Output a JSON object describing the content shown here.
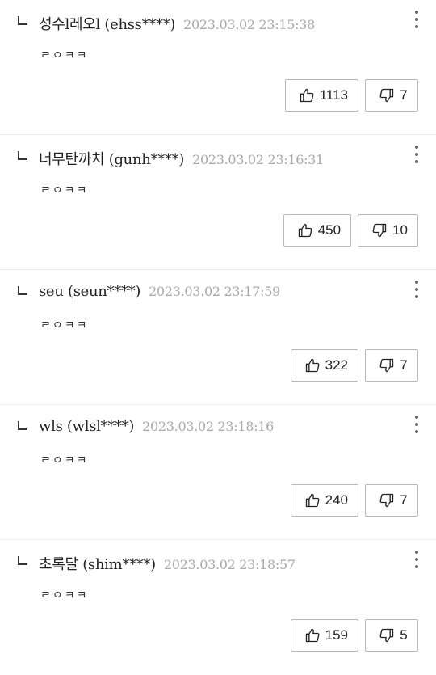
{
  "replies": [
    {
      "nickname": "성수l레오l (ehss****)",
      "date": "2023.03.02 23:15:38",
      "content": "ㄹㅇㅋㅋ",
      "likes": "1113",
      "dislikes": "7"
    },
    {
      "nickname": "너무탄까치 (gunh****)",
      "date": "2023.03.02 23:16:31",
      "content": "ㄹㅇㅋㅋ",
      "likes": "450",
      "dislikes": "10"
    },
    {
      "nickname": "seu (seun****)",
      "date": "2023.03.02 23:17:59",
      "content": "ㄹㅇㅋㅋ",
      "likes": "322",
      "dislikes": "7"
    },
    {
      "nickname": "wls (wlsl****)",
      "date": "2023.03.02 23:18:16",
      "content": "ㄹㅇㅋㅋ",
      "likes": "240",
      "dislikes": "7"
    },
    {
      "nickname": "초록달 (shim****)",
      "date": "2023.03.02 23:18:57",
      "content": "ㄹㅇㅋㅋ",
      "likes": "159",
      "dislikes": "5"
    }
  ],
  "icons": {
    "reply": "reply-arrow-icon",
    "more": "more-vertical-icon",
    "like": "thumbs-up-icon",
    "dislike": "thumbs-down-icon"
  }
}
